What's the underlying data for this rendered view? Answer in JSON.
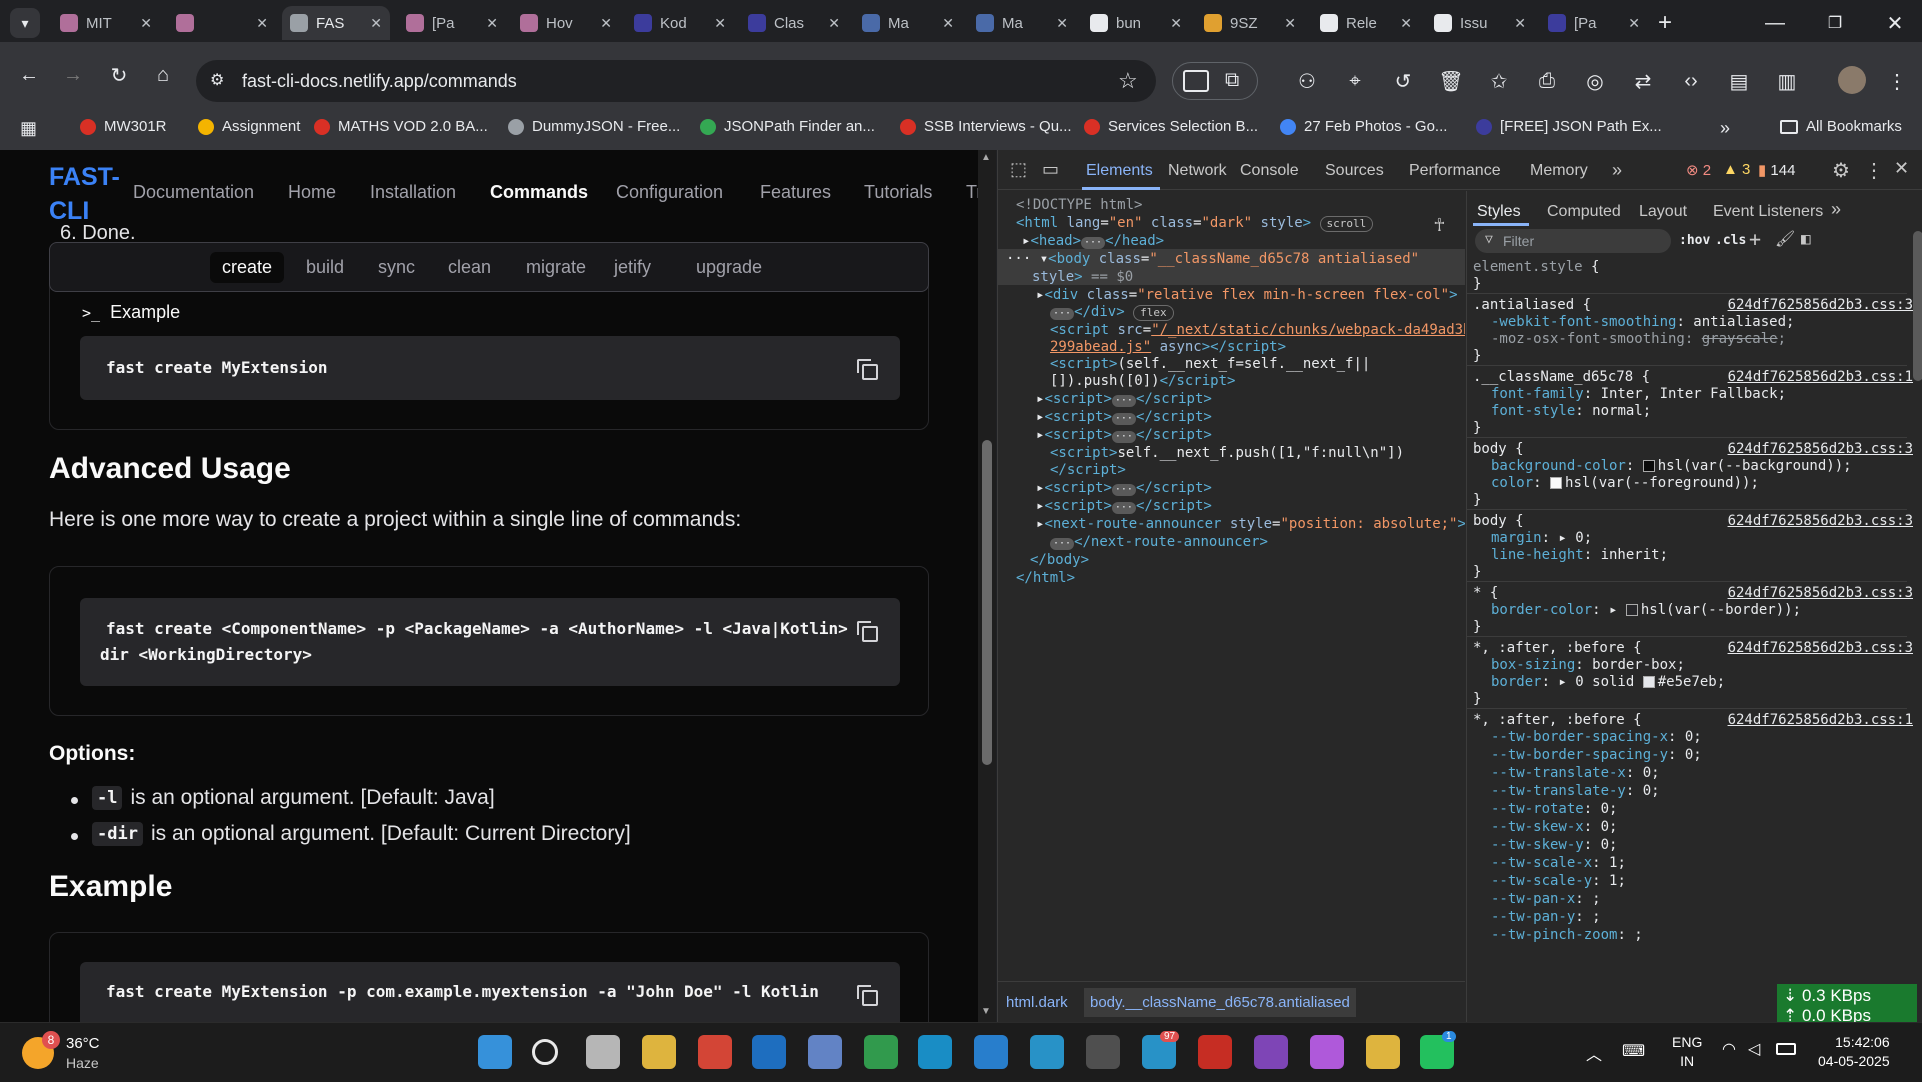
{
  "browser": {
    "tabs": [
      {
        "title": "MIT",
        "fav_color": "#b06f9a",
        "active": false
      },
      {
        "title": "",
        "fav_color": "#b06f9a",
        "active": false
      },
      {
        "title": "FAS",
        "fav_color": "#9aa0a6",
        "active": true
      },
      {
        "title": "[Pa",
        "fav_color": "#b06f9a",
        "active": false
      },
      {
        "title": "Hov",
        "fav_color": "#b06f9a",
        "active": false
      },
      {
        "title": "Kod",
        "fav_color": "#3c3c9c",
        "active": false
      },
      {
        "title": "Clas",
        "fav_color": "#3c3c9c",
        "active": false
      },
      {
        "title": "Ma",
        "fav_color": "#4a6aa8",
        "active": false
      },
      {
        "title": "Ma",
        "fav_color": "#4a6aa8",
        "active": false
      },
      {
        "title": "bun",
        "fav_color": "#e8eaed",
        "active": false
      },
      {
        "title": "9SZ",
        "fav_color": "#e0a030",
        "active": false
      },
      {
        "title": "Rele",
        "fav_color": "#e8eaed",
        "active": false
      },
      {
        "title": "Issu",
        "fav_color": "#e8eaed",
        "active": false
      },
      {
        "title": "[Pa",
        "fav_color": "#3c3c9c",
        "active": false
      }
    ],
    "url": "fast-cli-docs.netlify.app/commands",
    "bookmarks": [
      {
        "label": "MW301R",
        "color": "#d93025"
      },
      {
        "label": "Assignment",
        "color": "#f4b400"
      },
      {
        "label": "MATHS VOD 2.0 BA...",
        "color": "#d93025"
      },
      {
        "label": "DummyJSON - Free...",
        "color": "#9aa0a6"
      },
      {
        "label": "JSONPath Finder an...",
        "color": "#34a853"
      },
      {
        "label": "SSB Interviews - Qu...",
        "color": "#d93025"
      },
      {
        "label": "Services Selection B...",
        "color": "#d93025"
      },
      {
        "label": "27 Feb Photos - Go...",
        "color": "#4285f4"
      },
      {
        "label": "[FREE] JSON Path Ex...",
        "color": "#3c3c9c"
      }
    ],
    "all_bookmarks": "All Bookmarks"
  },
  "page": {
    "logo_line1": "FAST-",
    "logo_line2": "CLI",
    "nav": [
      "Documentation",
      "Home",
      "Installation",
      "Commands",
      "Configuration",
      "Features",
      "Tutorials",
      "Tr"
    ],
    "nav_active": "Commands",
    "cut_text": "6. Done.",
    "cmd_tabs": [
      "create",
      "build",
      "sync",
      "clean",
      "migrate",
      "jetify",
      "upgrade"
    ],
    "example_label": "Example",
    "example_code": "fast create MyExtension",
    "advanced_title": "Advanced Usage",
    "advanced_text": "Here is one more way to create a project within a single line of commands:",
    "advanced_code_line1": "fast create <ComponentName> -p <PackageName> -a <AuthorName> -l <Java|Kotlin>",
    "advanced_code_line2": "dir <WorkingDirectory>",
    "options_title": "Options:",
    "options": [
      {
        "code": "-l",
        "text": "is an optional argument. [Default: Java]"
      },
      {
        "code": "-dir",
        "text": "is an optional argument. [Default: Current Directory]"
      }
    ],
    "example_title": "Example",
    "example2_code": "fast create MyExtension -p com.example.myextension -a \"John Doe\" -l Kotlin"
  },
  "devtools": {
    "tabs": [
      "Elements",
      "Network",
      "Console",
      "Sources",
      "Performance",
      "Memory"
    ],
    "errors": "2",
    "warnings": "3",
    "issues": "144",
    "styles_tabs": [
      "Styles",
      "Computed",
      "Layout",
      "Event Listeners"
    ],
    "filter_placeholder": "Filter",
    "hov": ":hov",
    "cls": ".cls",
    "breadcrumb_1": "html.dark",
    "breadcrumb_2": "body.__className_d65c78.antialiased",
    "net_down": "0.3 KBps",
    "net_up": "0.0 KBps"
  },
  "taskbar": {
    "weather_temp": "36°C",
    "weather_desc": "Haze",
    "weather_badge": "8",
    "lang1": "ENG",
    "lang2": "IN",
    "time": "15:42:06",
    "date": "04-05-2025",
    "telegram_badge": "97",
    "whatsapp_badge": "1"
  }
}
